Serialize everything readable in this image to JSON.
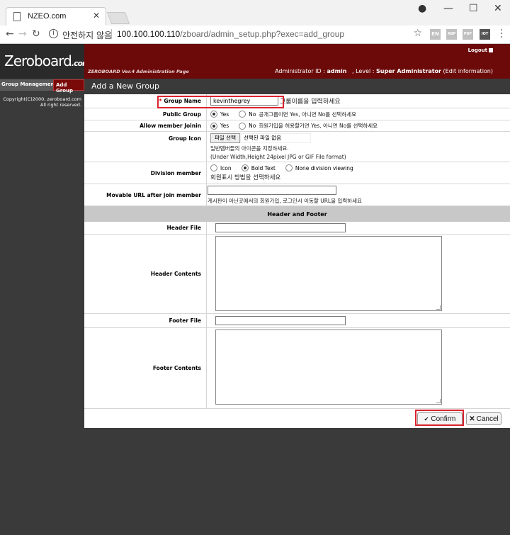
{
  "browser": {
    "tab_title": "NZEO.com",
    "secure_label": "안전하지 않음",
    "url_host": "100.100.100.110",
    "url_path": "/zboard/admin_setup.php?exec=add_group",
    "extensions": [
      "EN",
      "ABP",
      "PDF",
      "IOT"
    ]
  },
  "header": {
    "logo_main": "Zeroboard",
    "logo_suffix": ".com",
    "logout": "Logout",
    "admin_page": "ZEROBOARD Ver.4 Administration Page",
    "admin_id_label": "Administrator ID :",
    "admin_id": "admin",
    "level_label": ", Level :",
    "level": "Super Administrator",
    "edit_info": "(Edit information)"
  },
  "sidebar": {
    "group_management": "Group Management",
    "add_group": "Add Group",
    "copyright_line1": "Copyright(C)2000, zeroboard.com",
    "copyright_line2": "All right reserved."
  },
  "page": {
    "title": "Add a New Group"
  },
  "form": {
    "group_name": {
      "required": "*",
      "label": "Group Name",
      "value": "kevinthegrey",
      "hint": "그룹이름을 입력하세요"
    },
    "public_group": {
      "label": "Public Group",
      "yes": "Yes",
      "no": "No",
      "hint": "공개그룹이면 Yes, 아니면 No를 선택하세요",
      "selected": "yes"
    },
    "allow_join": {
      "label": "Allow member Joinin",
      "yes": "Yes",
      "no": "No",
      "hint": "회원가입을 허용할거면 Yes, 아니면 No를 선택하세요",
      "selected": "yes"
    },
    "group_icon": {
      "label": "Group Icon",
      "button": "파일 선택",
      "status": "선택된 파일 없음",
      "hint1": "일반멤버들의 아이콘을 지정하세요.",
      "hint2": "(Under Width,Height 24pixel JPG or GIF File format)"
    },
    "division_member": {
      "label": "Division member",
      "icon": "Icon",
      "bold_text": "Bold Text",
      "none": "None division viewing",
      "hint": "회원표시 방법을 선택하세요",
      "selected": "bold_text"
    },
    "movable_url": {
      "label": "Movable URL after join member",
      "value": "",
      "hint": "게시판이 아닌곳에서의 회원가입, 로그인시 이동할 URL을 입력하세요"
    },
    "section_header_footer": "Header and Footer",
    "header_file": {
      "label": "Header File",
      "value": ""
    },
    "header_contents": {
      "label": "Header Contents",
      "value": ""
    },
    "footer_file": {
      "label": "Footer File",
      "value": ""
    },
    "footer_contents": {
      "label": "Footer Contents",
      "value": ""
    }
  },
  "actions": {
    "confirm": "Confirm",
    "cancel": "Cancel"
  },
  "colors": {
    "header_bg": "#6c0a0a",
    "sidebar_bg": "#3a3a3a",
    "highlight": "#d9232e"
  }
}
